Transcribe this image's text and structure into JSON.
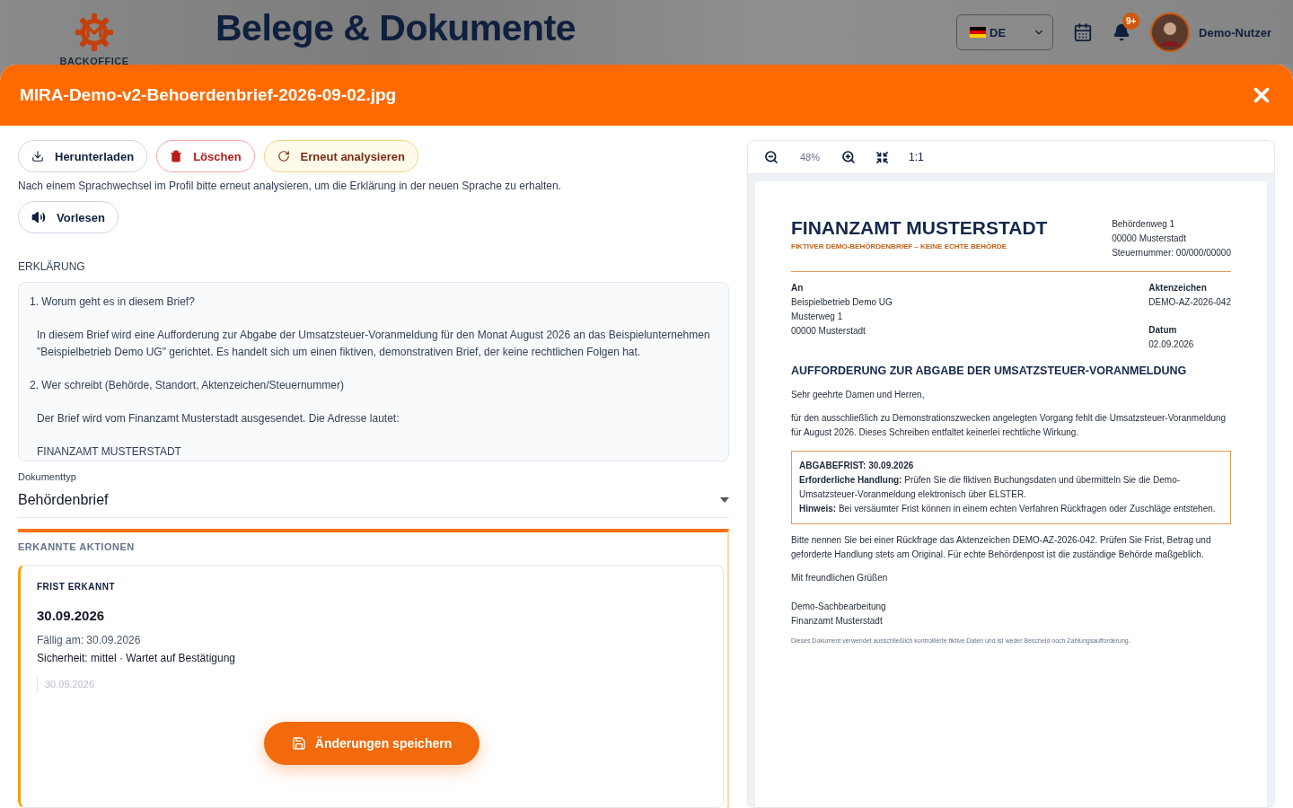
{
  "app_header": {
    "logo_text": "BACKOFFICE",
    "title": "Belege & Dokumente",
    "language": {
      "code": "DE"
    },
    "notifications_badge": "9+",
    "user_name": "Demo-Nutzer"
  },
  "modal": {
    "title": "MIRA-Demo-v2-Behoerdenbrief-2026-09-02.jpg"
  },
  "toolbar_buttons": [
    {
      "label": "Herunterladen",
      "kind": "download"
    },
    {
      "label": "Löschen",
      "kind": "delete"
    },
    {
      "label": "Erneut analysieren",
      "kind": "reanalyze"
    }
  ],
  "hint": "Nach einem Sprachwechsel im Profil bitte erneut analysieren, um die Erklärung in der neuen Sprache zu erhalten.",
  "read_aloud": {
    "label": "Vorlesen"
  },
  "explanation": {
    "label": "ERKLÄRUNG",
    "paragraphs": [
      {
        "text": "1. Worum geht es in diesem Brief?",
        "indented": false
      },
      {
        "text": "In diesem Brief wird eine Aufforderung zur Abgabe der Umsatzsteuer-Voranmeldung für den Monat August 2026 an das Beispielunternehmen \"Beispielbetrieb Demo UG\" gerichtet. Es handelt sich um einen fiktiven, demonstrativen Brief, der keine rechtlichen Folgen hat.",
        "indented": true
      },
      {
        "text": "2. Wer schreibt (Behörde, Standort, Aktenzeichen/Steuernummer)",
        "indented": false
      },
      {
        "text": "Der Brief wird vom Finanzamt Musterstadt ausgesendet. Die Adresse lautet:",
        "indented": true
      },
      {
        "text": "FINANZAMT MUSTERSTADT",
        "indented": true
      }
    ]
  },
  "document_type": {
    "label": "Dokumenttyp",
    "value": "Behördenbrief"
  },
  "actions_section": {
    "title": "ERKANNTE AKTIONEN",
    "items": [
      {
        "type_label": "FRIST ERKANNT",
        "date": "30.09.2026",
        "due": "Fällig am: 30.09.2026",
        "meta": "Sicherheit: mittel · Wartet auf Bestätigung",
        "input_value": "30.09.2026"
      }
    ]
  },
  "save_button": {
    "label": "Änderungen speichern"
  },
  "viewer": {
    "zoom": "48%",
    "reset_label": "1:1",
    "letter": {
      "authority": "FINANZAMT MUSTERSTADT",
      "subtitle": "FIKTIVER DEMO-BEHÖRDENBRIEF – KEINE ECHTE BEHÖRDE",
      "sender_lines": [
        "Behördenweg 1",
        "00000 Musterstadt",
        "Steuernummer: 00/000/00000"
      ],
      "recipient": {
        "label": "An",
        "lines": [
          "Beispielbetrieb Demo UG",
          "Musterweg 1",
          "00000 Musterstadt"
        ]
      },
      "meta": [
        {
          "label": "Aktenzeichen",
          "value": "DEMO-AZ-2026-042"
        },
        {
          "label": "Datum",
          "value": "02.09.2026"
        }
      ],
      "subject": "AUFFORDERUNG ZUR ABGABE DER UMSATZSTEUER-VORANMELDUNG",
      "salutation": "Sehr geehrte Damen und Herren,",
      "intro": "für den ausschließlich zu Demonstrationszwecken angelegten Vorgang fehlt die Umsatzsteuer-Voranmeldung für August 2026. Dieses Schreiben entfaltet keinerlei rechtliche Wirkung.",
      "notice": [
        "**ABGABEFRIST: 30.09.2026**",
        "**Erforderliche Handlung:** Prüfen Sie die fiktiven Buchungsdaten und übermitteln Sie die Demo-Umsatzsteuer-Voranmeldung elektronisch über ELSTER.",
        "**Hinweis:** Bei versäumter Frist können in einem echten Verfahren Rückfragen oder Zuschläge entstehen."
      ],
      "body": "Bitte nennen Sie bei einer Rückfrage das Aktenzeichen DEMO-AZ-2026-042. Prüfen Sie Frist, Betrag und geforderte Handlung stets am Original. Für echte Behördenpost ist die zuständige Behörde maßgeblich.",
      "closing": "Mit freundlichen Grüßen",
      "signature": [
        "Demo-Sachbearbeitung",
        "Finanzamt Musterstadt"
      ],
      "footnote": "Dieses Dokument verwendet ausschließlich kontrollierte fiktive Daten und ist weder Bescheid noch Zahlungsaufforderung."
    }
  }
}
